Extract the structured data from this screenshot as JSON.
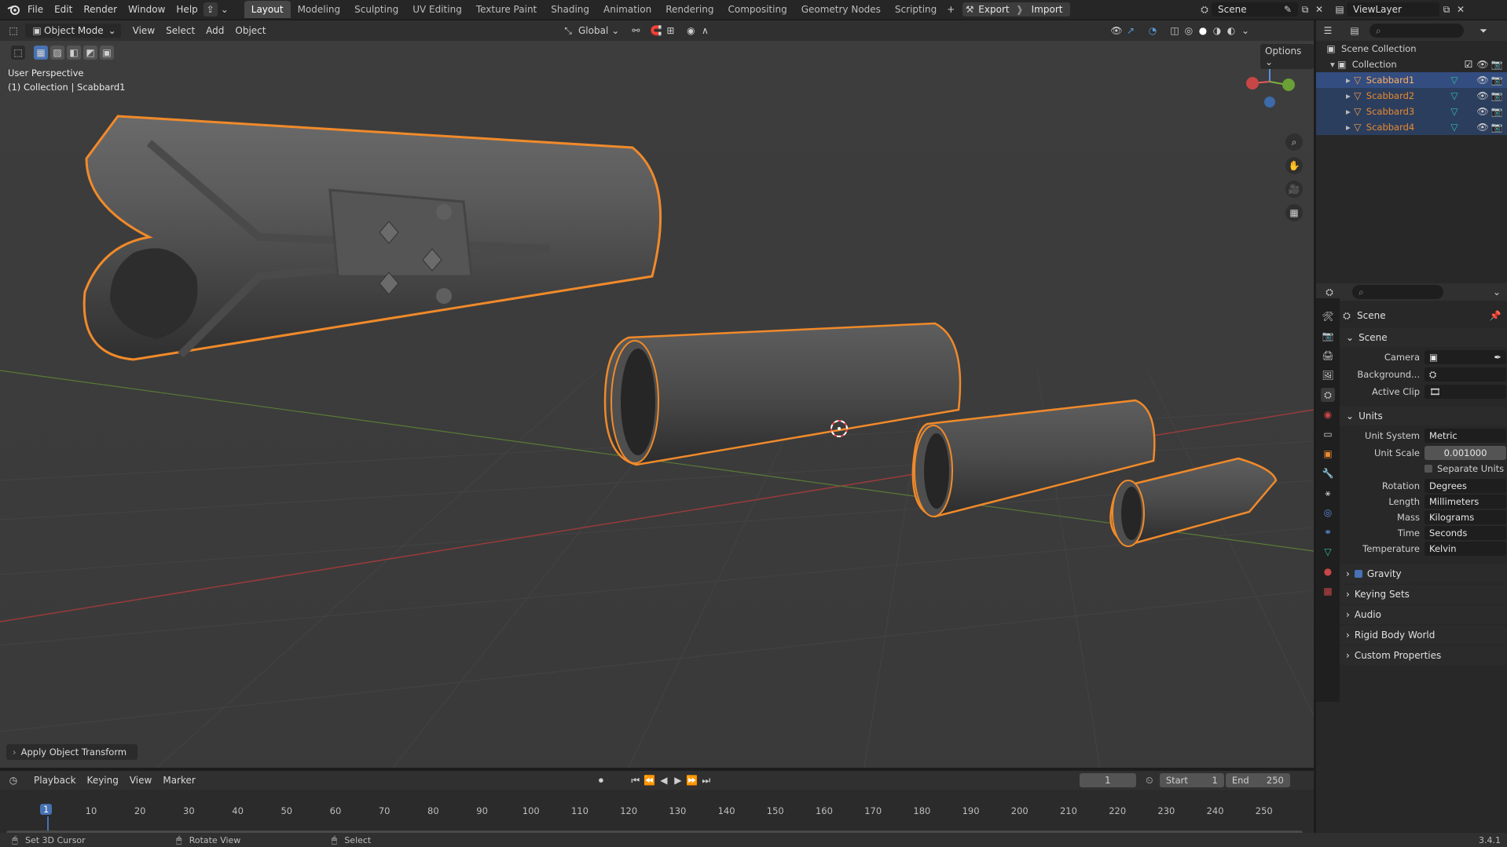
{
  "topbar": {
    "menus": [
      "File",
      "Edit",
      "Render",
      "Window",
      "Help"
    ],
    "workspaces": [
      "Layout",
      "Modeling",
      "Sculpting",
      "UV Editing",
      "Texture Paint",
      "Shading",
      "Animation",
      "Rendering",
      "Compositing",
      "Geometry Nodes",
      "Scripting"
    ],
    "active_workspace": "Layout",
    "export_label": "Export",
    "import_label": "Import",
    "scene_name": "Scene",
    "view_layer": "ViewLayer"
  },
  "viewport_header": {
    "mode": "Object Mode",
    "menus": [
      "View",
      "Select",
      "Add",
      "Object"
    ],
    "orientation": "Global",
    "options_label": "Options"
  },
  "viewport": {
    "perspective_label": "User Perspective",
    "collection_label": "(1) Collection | Scabbard1",
    "last_op": "Apply Object Transform",
    "gizmo_axes": {
      "z": "Z"
    },
    "selection_color": "#f08a2a",
    "objects": [
      "Scabbard1",
      "Scabbard2",
      "Scabbard3",
      "Scabbard4"
    ]
  },
  "outliner": {
    "root": "Scene Collection",
    "collection": "Collection",
    "items": [
      "Scabbard1",
      "Scabbard2",
      "Scabbard3",
      "Scabbard4"
    ]
  },
  "properties": {
    "context": "Scene",
    "scene_panel": {
      "title": "Scene",
      "camera_label": "Camera",
      "background_label": "Background...",
      "active_clip_label": "Active Clip"
    },
    "units_panel": {
      "title": "Units",
      "unit_system_label": "Unit System",
      "unit_system": "Metric",
      "unit_scale_label": "Unit Scale",
      "unit_scale": "0.001000",
      "separate_units": "Separate Units",
      "rotation_label": "Rotation",
      "rotation": "Degrees",
      "length_label": "Length",
      "length": "Millimeters",
      "mass_label": "Mass",
      "mass": "Kilograms",
      "time_label": "Time",
      "time": "Seconds",
      "temperature_label": "Temperature",
      "temperature": "Kelvin"
    },
    "collapsed_panels": [
      "Gravity",
      "Keying Sets",
      "Audio",
      "Rigid Body World",
      "Custom Properties"
    ]
  },
  "timeline": {
    "menus": [
      "Playback",
      "Keying",
      "View",
      "Marker"
    ],
    "current_frame": "1",
    "start_label": "Start",
    "start": "1",
    "end_label": "End",
    "end": "250",
    "ticks": [
      "1",
      "10",
      "20",
      "30",
      "40",
      "50",
      "60",
      "70",
      "80",
      "90",
      "100",
      "110",
      "120",
      "130",
      "140",
      "150",
      "160",
      "170",
      "180",
      "190",
      "200",
      "210",
      "220",
      "230",
      "240",
      "250"
    ]
  },
  "statusbar": {
    "items": [
      "Set 3D Cursor",
      "Rotate View",
      "Select"
    ],
    "version": "3.4.1"
  }
}
